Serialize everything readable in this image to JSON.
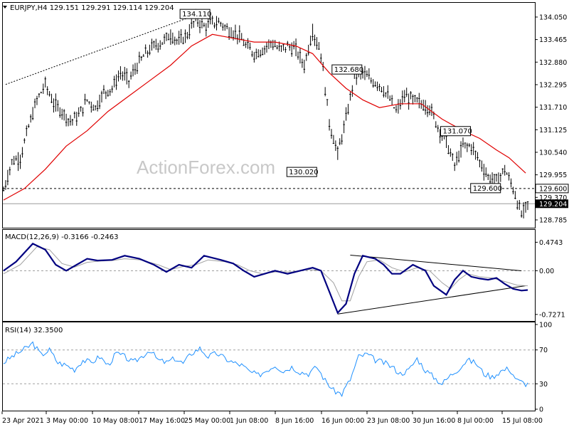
{
  "chart_data": [
    {
      "type": "candlestick",
      "panel": "price",
      "header": "EURJPY,H4  129.151 129.291 129.114 129.204",
      "watermark": "ActionForex.com",
      "y_ticks": [
        "134.050",
        "133.465",
        "132.880",
        "132.295",
        "131.710",
        "131.125",
        "130.540",
        "129.955",
        "129.370",
        "128.785"
      ],
      "ylim": [
        128.6,
        134.4
      ],
      "current_price": "129.204",
      "support_line": "129.600",
      "x_ticks": [
        "23 Apr 2021",
        "3 May 00:00",
        "10 May 08:00",
        "17 May 16:00",
        "25 May 00:00",
        "1 Jun 08:00",
        "8 Jun 16:00",
        "16 Jun 00:00",
        "23 Jun 08:00",
        "30 Jun 16:00",
        "8 Jul 00:00",
        "15 Jul 08:00"
      ],
      "annotations": [
        "134.110",
        "132.680",
        "130.020",
        "131.070",
        "129.600"
      ],
      "close_path": [
        [
          0,
          129.55
        ],
        [
          4,
          130.3
        ],
        [
          8,
          130.4
        ],
        [
          12,
          131.2
        ],
        [
          16,
          131.9
        ],
        [
          20,
          132.3
        ],
        [
          24,
          131.8
        ],
        [
          28,
          131.6
        ],
        [
          32,
          131.35
        ],
        [
          36,
          131.5
        ],
        [
          40,
          131.9
        ],
        [
          44,
          131.7
        ],
        [
          48,
          132.1
        ],
        [
          52,
          132.2
        ],
        [
          56,
          132.6
        ],
        [
          60,
          132.4
        ],
        [
          64,
          132.8
        ],
        [
          68,
          133.1
        ],
        [
          72,
          133.3
        ],
        [
          76,
          133.4
        ],
        [
          80,
          133.6
        ],
        [
          84,
          133.4
        ],
        [
          88,
          133.6
        ],
        [
          92,
          134.0
        ],
        [
          96,
          133.8
        ],
        [
          100,
          133.9
        ],
        [
          104,
          133.9
        ],
        [
          108,
          133.7
        ],
        [
          112,
          133.6
        ],
        [
          116,
          133.3
        ],
        [
          120,
          133.1
        ],
        [
          124,
          133.2
        ],
        [
          128,
          133.4
        ],
        [
          132,
          133.2
        ],
        [
          136,
          133.3
        ],
        [
          140,
          133.2
        ],
        [
          144,
          132.8
        ],
        [
          148,
          133.7
        ],
        [
          152,
          133.1
        ],
        [
          156,
          131.3
        ],
        [
          160,
          130.5
        ],
        [
          164,
          131.4
        ],
        [
          168,
          132.5
        ],
        [
          172,
          132.6
        ],
        [
          176,
          132.4
        ],
        [
          180,
          132.3
        ],
        [
          184,
          132.0
        ],
        [
          188,
          131.6
        ],
        [
          192,
          132.0
        ],
        [
          196,
          131.9
        ],
        [
          200,
          131.8
        ],
        [
          204,
          131.7
        ],
        [
          208,
          131.2
        ],
        [
          212,
          130.8
        ],
        [
          216,
          130.2
        ],
        [
          220,
          130.7
        ],
        [
          224,
          130.7
        ],
        [
          228,
          130.3
        ],
        [
          232,
          129.9
        ],
        [
          236,
          129.8
        ],
        [
          240,
          130.1
        ],
        [
          244,
          129.6
        ],
        [
          248,
          128.9
        ],
        [
          251,
          129.2
        ]
      ],
      "ma_path": [
        [
          0,
          129.3
        ],
        [
          10,
          129.6
        ],
        [
          20,
          130.1
        ],
        [
          30,
          130.7
        ],
        [
          40,
          131.1
        ],
        [
          50,
          131.6
        ],
        [
          60,
          132.0
        ],
        [
          70,
          132.4
        ],
        [
          80,
          132.8
        ],
        [
          90,
          133.3
        ],
        [
          100,
          133.6
        ],
        [
          110,
          133.5
        ],
        [
          120,
          133.4
        ],
        [
          130,
          133.4
        ],
        [
          140,
          133.3
        ],
        [
          148,
          133.1
        ],
        [
          156,
          132.6
        ],
        [
          164,
          132.2
        ],
        [
          172,
          131.9
        ],
        [
          180,
          131.7
        ],
        [
          190,
          131.8
        ],
        [
          200,
          131.8
        ],
        [
          210,
          131.4
        ],
        [
          220,
          131.1
        ],
        [
          228,
          130.9
        ],
        [
          236,
          130.6
        ],
        [
          242,
          130.4
        ],
        [
          250,
          130.0
        ]
      ],
      "trendline_start": [
        1,
        132.3
      ],
      "trendline_end": [
        92,
        134.1
      ]
    },
    {
      "type": "line",
      "panel": "macd",
      "header": "MACD(12,26,9) -0.3166 -0.2463",
      "y_ticks": [
        "0.4743",
        "0.00",
        "-0.7271"
      ],
      "ylim": [
        -0.8,
        0.55
      ],
      "series": [
        {
          "role": "macd",
          "color": "#000080",
          "points": [
            [
              0,
              0.0
            ],
            [
              6,
              0.15
            ],
            [
              14,
              0.45
            ],
            [
              20,
              0.35
            ],
            [
              25,
              0.1
            ],
            [
              30,
              0.0
            ],
            [
              35,
              0.1
            ],
            [
              40,
              0.2
            ],
            [
              45,
              0.17
            ],
            [
              52,
              0.18
            ],
            [
              58,
              0.25
            ],
            [
              65,
              0.2
            ],
            [
              72,
              0.1
            ],
            [
              78,
              -0.02
            ],
            [
              84,
              0.1
            ],
            [
              90,
              0.05
            ],
            [
              96,
              0.25
            ],
            [
              104,
              0.18
            ],
            [
              110,
              0.12
            ],
            [
              115,
              0.0
            ],
            [
              120,
              -0.1
            ],
            [
              125,
              -0.05
            ],
            [
              130,
              0.0
            ],
            [
              136,
              -0.05
            ],
            [
              142,
              0.0
            ],
            [
              148,
              0.05
            ],
            [
              152,
              0.0
            ],
            [
              156,
              -0.35
            ],
            [
              160,
              -0.7
            ],
            [
              164,
              -0.55
            ],
            [
              168,
              -0.05
            ],
            [
              172,
              0.25
            ],
            [
              178,
              0.2
            ],
            [
              182,
              0.1
            ],
            [
              186,
              -0.05
            ],
            [
              190,
              -0.05
            ],
            [
              196,
              0.1
            ],
            [
              202,
              0.0
            ],
            [
              206,
              -0.25
            ],
            [
              212,
              -0.4
            ],
            [
              216,
              -0.15
            ],
            [
              220,
              0.0
            ],
            [
              224,
              -0.1
            ],
            [
              228,
              -0.13
            ],
            [
              232,
              -0.15
            ],
            [
              236,
              -0.12
            ],
            [
              240,
              -0.22
            ],
            [
              244,
              -0.3
            ],
            [
              248,
              -0.33
            ],
            [
              251,
              -0.32
            ]
          ]
        },
        {
          "role": "signal",
          "color": "#a0a0a0",
          "points": [
            [
              0,
              -0.05
            ],
            [
              8,
              0.1
            ],
            [
              16,
              0.4
            ],
            [
              22,
              0.35
            ],
            [
              28,
              0.12
            ],
            [
              34,
              0.06
            ],
            [
              40,
              0.14
            ],
            [
              46,
              0.16
            ],
            [
              52,
              0.17
            ],
            [
              58,
              0.2
            ],
            [
              66,
              0.18
            ],
            [
              74,
              0.1
            ],
            [
              80,
              0.02
            ],
            [
              86,
              0.07
            ],
            [
              92,
              0.1
            ],
            [
              98,
              0.18
            ],
            [
              106,
              0.15
            ],
            [
              112,
              0.1
            ],
            [
              118,
              0.0
            ],
            [
              124,
              -0.05
            ],
            [
              130,
              -0.02
            ],
            [
              138,
              -0.02
            ],
            [
              146,
              0.02
            ],
            [
              152,
              0.0
            ],
            [
              158,
              -0.2
            ],
            [
              162,
              -0.5
            ],
            [
              166,
              -0.5
            ],
            [
              170,
              -0.1
            ],
            [
              174,
              0.15
            ],
            [
              180,
              0.18
            ],
            [
              186,
              0.05
            ],
            [
              192,
              -0.02
            ],
            [
              198,
              0.05
            ],
            [
              204,
              0.0
            ],
            [
              210,
              -0.2
            ],
            [
              214,
              -0.3
            ],
            [
              218,
              -0.15
            ],
            [
              222,
              -0.05
            ],
            [
              228,
              -0.1
            ],
            [
              234,
              -0.12
            ],
            [
              240,
              -0.18
            ],
            [
              246,
              -0.24
            ],
            [
              251,
              -0.25
            ]
          ]
        }
      ],
      "trendline_upper": [
        [
          166,
          0.26
        ],
        [
          248,
          0.0
        ]
      ],
      "trendline_lower": [
        [
          160,
          -0.72
        ],
        [
          250,
          -0.25
        ]
      ]
    },
    {
      "type": "line",
      "panel": "rsi",
      "header": "RSI(14) 32.3500",
      "y_ticks": [
        "100",
        "70",
        "30",
        "0"
      ],
      "ylim": [
        0,
        100
      ],
      "series": [
        {
          "role": "rsi",
          "color": "#1e90ff",
          "points": [
            [
              0,
              55
            ],
            [
              4,
              62
            ],
            [
              8,
              68
            ],
            [
              12,
              74
            ],
            [
              14,
              78
            ],
            [
              18,
              64
            ],
            [
              22,
              70
            ],
            [
              26,
              55
            ],
            [
              30,
              52
            ],
            [
              34,
              47
            ],
            [
              38,
              58
            ],
            [
              42,
              55
            ],
            [
              46,
              62
            ],
            [
              50,
              52
            ],
            [
              54,
              66
            ],
            [
              58,
              62
            ],
            [
              62,
              55
            ],
            [
              66,
              62
            ],
            [
              70,
              70
            ],
            [
              74,
              58
            ],
            [
              78,
              55
            ],
            [
              82,
              60
            ],
            [
              86,
              54
            ],
            [
              90,
              66
            ],
            [
              94,
              72
            ],
            [
              98,
              62
            ],
            [
              102,
              66
            ],
            [
              106,
              60
            ],
            [
              110,
              55
            ],
            [
              114,
              52
            ],
            [
              118,
              44
            ],
            [
              122,
              40
            ],
            [
              126,
              46
            ],
            [
              130,
              52
            ],
            [
              134,
              45
            ],
            [
              138,
              50
            ],
            [
              142,
              44
            ],
            [
              146,
              42
            ],
            [
              150,
              50
            ],
            [
              154,
              34
            ],
            [
              158,
              22
            ],
            [
              162,
              18
            ],
            [
              166,
              35
            ],
            [
              170,
              62
            ],
            [
              174,
              65
            ],
            [
              178,
              58
            ],
            [
              182,
              55
            ],
            [
              186,
              50
            ],
            [
              190,
              42
            ],
            [
              194,
              46
            ],
            [
              198,
              60
            ],
            [
              202,
              46
            ],
            [
              206,
              38
            ],
            [
              210,
              30
            ],
            [
              214,
              40
            ],
            [
              218,
              48
            ],
            [
              222,
              58
            ],
            [
              226,
              55
            ],
            [
              230,
              42
            ],
            [
              234,
              38
            ],
            [
              238,
              45
            ],
            [
              242,
              48
            ],
            [
              246,
              34
            ],
            [
              250,
              30
            ]
          ]
        }
      ],
      "levels": [
        70,
        30
      ]
    }
  ]
}
